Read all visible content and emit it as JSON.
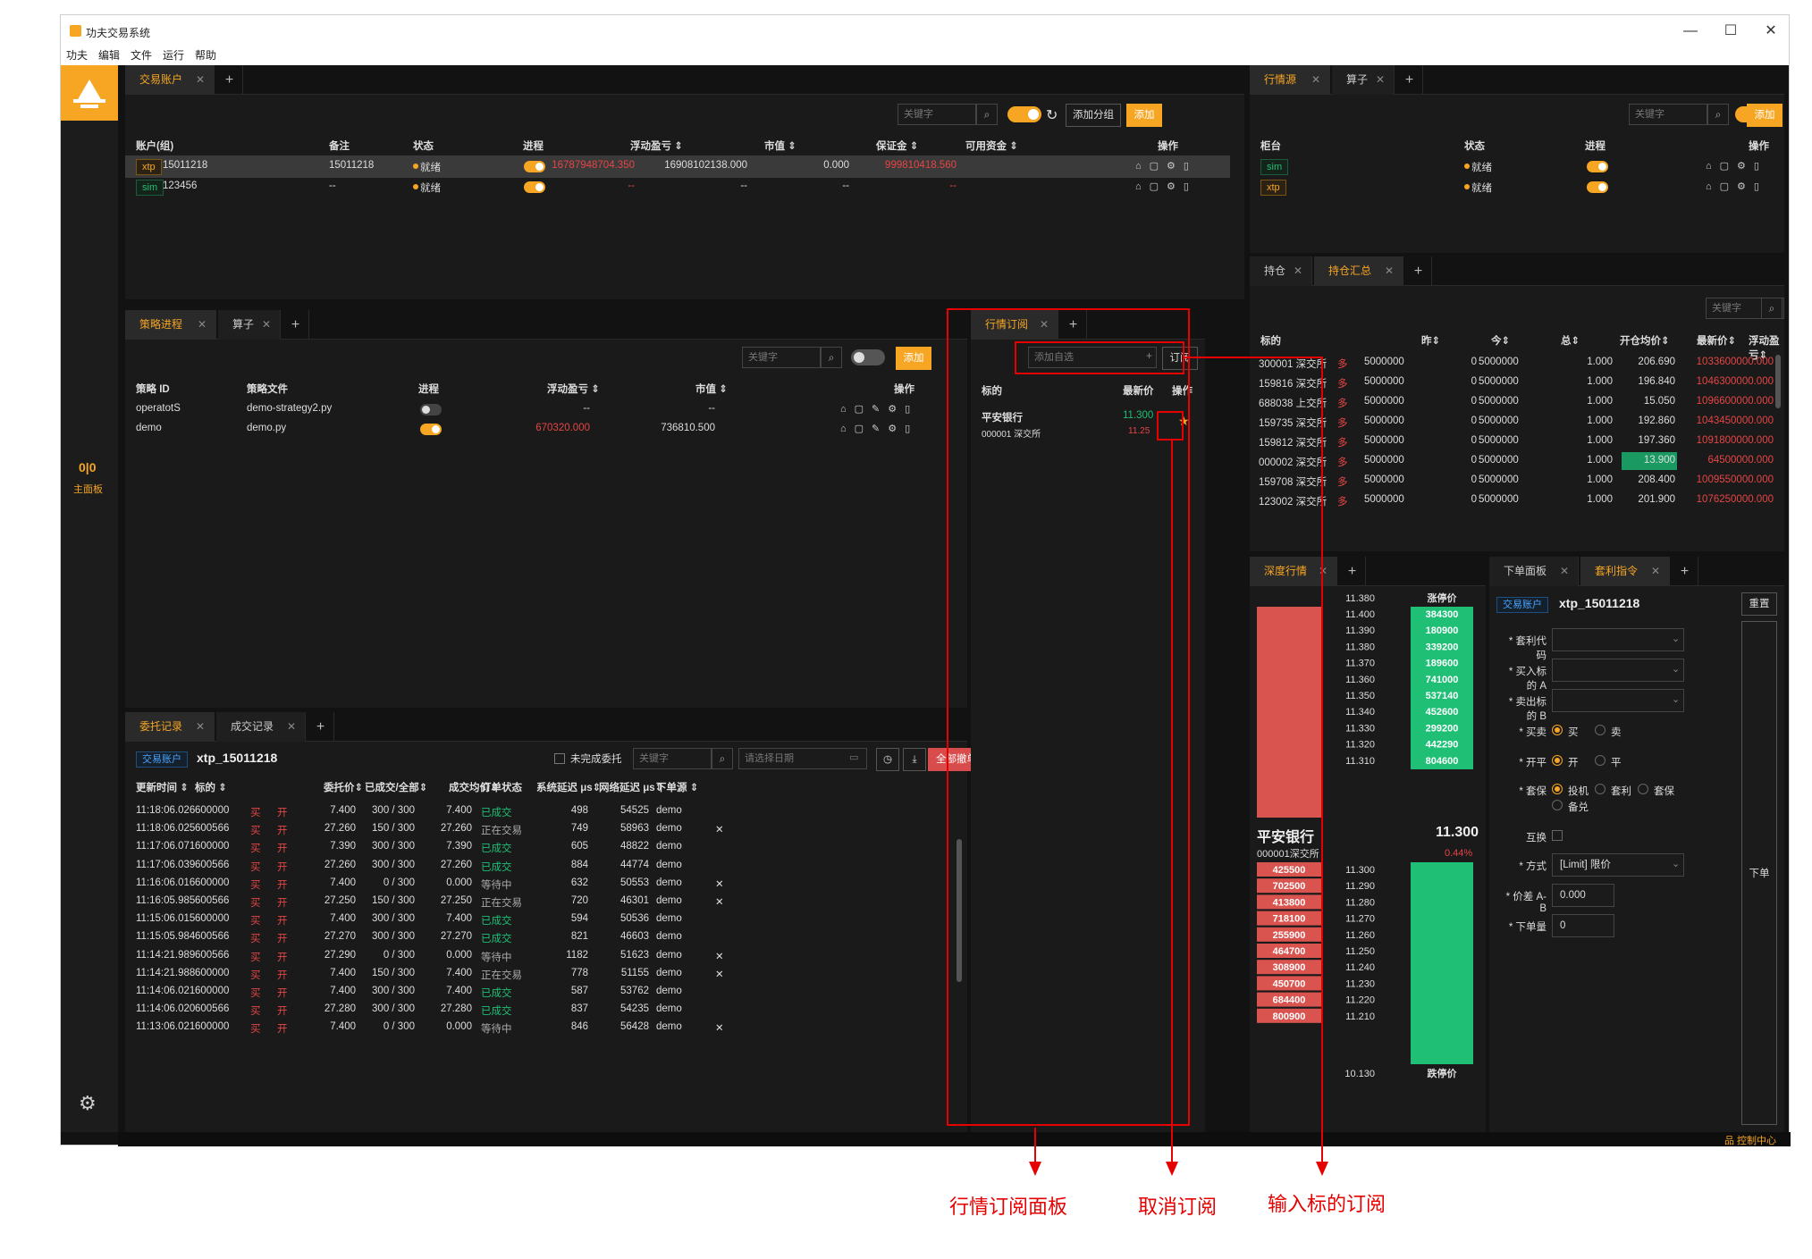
{
  "app": {
    "title": "功夫交易系统",
    "menu": [
      "功夫",
      "编辑",
      "文件",
      "运行",
      "帮助"
    ],
    "win_controls": [
      "—",
      "☐",
      "✕"
    ]
  },
  "sidebar": {
    "main_label": "主面板",
    "main_icon_text": "0|0"
  },
  "common": {
    "search_placeholder": "关键字",
    "add": "添加",
    "add_group": "添加分组",
    "close": "✕",
    "plus": "+"
  },
  "accounts": {
    "tab": "交易账户",
    "headers": [
      "账户(组)",
      "备注",
      "状态",
      "进程",
      "浮动盈亏 ⇕",
      "市值 ⇕",
      "保证金 ⇕",
      "可用资金 ⇕",
      "操作"
    ],
    "rows": [
      {
        "source": "xtp",
        "id": "15011218",
        "note": "15011218",
        "status": "就绪",
        "pnl": "16787948704.350",
        "mv": "16908102138.000",
        "margin": "0.000",
        "avail": "999810418.560",
        "selected": true
      },
      {
        "source": "sim",
        "id": "123456",
        "note": "--",
        "status": "就绪",
        "pnl": "--",
        "mv": "--",
        "margin": "--",
        "avail": "--",
        "selected": false
      }
    ]
  },
  "md_source": {
    "tabs": [
      "行情源",
      "算子"
    ],
    "headers": [
      "柜台",
      "状态",
      "进程",
      "操作"
    ],
    "rows": [
      {
        "source": "sim",
        "status": "就绪"
      },
      {
        "source": "xtp",
        "status": "就绪"
      }
    ]
  },
  "positions": {
    "tabs": [
      "持仓",
      "持仓汇总"
    ],
    "headers": [
      "标的",
      "昨⇕",
      "今⇕",
      "总⇕",
      "开仓均价⇕",
      "最新价⇕",
      "浮动盈亏⇕"
    ],
    "rows": [
      [
        "300001 深交所",
        "多",
        "5000000",
        "0",
        "5000000",
        "1.000",
        "206.690",
        "1033600000.000"
      ],
      [
        "159816 深交所",
        "多",
        "5000000",
        "0",
        "5000000",
        "1.000",
        "196.840",
        "1046300000.000"
      ],
      [
        "688038 上交所",
        "多",
        "5000000",
        "0",
        "5000000",
        "1.000",
        "15.050",
        "1096600000.000"
      ],
      [
        "159735 深交所",
        "多",
        "5000000",
        "0",
        "5000000",
        "1.000",
        "192.860",
        "1043450000.000"
      ],
      [
        "159812 深交所",
        "多",
        "5000000",
        "0",
        "5000000",
        "1.000",
        "197.360",
        "1091800000.000"
      ],
      [
        "000002 深交所",
        "多",
        "5000000",
        "0",
        "5000000",
        "1.000",
        "13.900",
        "64500000.000"
      ],
      [
        "159708 深交所",
        "多",
        "5000000",
        "0",
        "5000000",
        "1.000",
        "208.400",
        "1009550000.000"
      ],
      [
        "123002 深交所",
        "多",
        "5000000",
        "0",
        "5000000",
        "1.000",
        "201.900",
        "1076250000.000"
      ]
    ]
  },
  "strategy": {
    "tabs": [
      "策略进程",
      "算子"
    ],
    "headers": [
      "策略 ID",
      "策略文件",
      "进程",
      "浮动盈亏 ⇕",
      "市值 ⇕",
      "操作"
    ],
    "rows": [
      {
        "id": "operatotS",
        "file": "demo-strategy2.py",
        "on": false,
        "pnl": "--",
        "mv": "--"
      },
      {
        "id": "demo",
        "file": "demo.py",
        "on": true,
        "pnl": "670320.000",
        "mv": "736810.500"
      }
    ]
  },
  "market_sub": {
    "tab": "行情订阅",
    "input_placeholder": "添加自选",
    "subscribe_btn": "订阅",
    "headers": [
      "标的",
      "最新价",
      "操作"
    ],
    "rows": [
      {
        "name": "平安银行",
        "code": "000001 深交所",
        "price": "11.300",
        "sub_price": "11.25"
      }
    ]
  },
  "depth": {
    "tab": "深度行情",
    "name": "平安银行",
    "code": "000001深交所",
    "price": "11.300",
    "change": "0.44%",
    "top_price": "11.380",
    "bottom_price": "10.130",
    "limit_up": "涨停价",
    "limit_down": "跌停价",
    "ask_prices": [
      "11.400",
      "11.390",
      "11.380",
      "11.370",
      "11.360",
      "11.350",
      "11.340",
      "11.330",
      "11.320",
      "11.310"
    ],
    "ask_vols": [
      "384300",
      "180900",
      "339200",
      "189600",
      "741000",
      "537140",
      "452600",
      "299200",
      "442290",
      "804600"
    ],
    "bid_prices": [
      "11.300",
      "11.290",
      "11.280",
      "11.270",
      "11.260",
      "11.250",
      "11.240",
      "11.230",
      "11.220",
      "11.210"
    ],
    "bid_vols": [
      "425500",
      "702500",
      "413800",
      "718100",
      "255900",
      "464700",
      "308900",
      "450700",
      "684400",
      "800900"
    ]
  },
  "order_panel": {
    "tabs": [
      "下单面板",
      "套利指令"
    ],
    "account_tag": "交易账户",
    "account": "xtp_15011218",
    "reset": "重置",
    "submit": "下单",
    "labels": [
      "* 套利代码",
      "* 买入标的 A",
      "* 卖出标的 B",
      "* 买卖",
      "* 开平",
      "* 套保",
      "互换",
      "* 方式",
      "* 价差 A-B",
      "* 下单量"
    ],
    "side_opts": [
      "买",
      "卖"
    ],
    "offset_opts": [
      "开",
      "平"
    ],
    "hedge_opts": [
      "投机",
      "套利",
      "套保",
      "备兑"
    ],
    "method": "[Limit] 限价",
    "spread": "0.000",
    "volume": "0"
  },
  "orders": {
    "tabs": [
      "委托记录",
      "成交记录"
    ],
    "account_tag": "交易账户",
    "account": "xtp_15011218",
    "unfinished": "未完成委托",
    "date_placeholder": "请选择日期",
    "cancel_all": "全部撤单",
    "headers": [
      "更新时间 ⇕",
      "标的 ⇕",
      "",
      "",
      "委托价⇕",
      "已成交/全部⇕",
      "成交均价⇕",
      "订单状态",
      "系统延迟 μs⇕",
      "网络延迟 μs⇕",
      "下单源 ⇕"
    ],
    "rows": [
      [
        "11:18:06.026",
        "600000",
        "买",
        "开",
        "7.400",
        "300 / 300",
        "7.400",
        "已成交",
        "498",
        "54525",
        "demo",
        ""
      ],
      [
        "11:18:06.025",
        "600566",
        "买",
        "开",
        "27.260",
        "150 / 300",
        "27.260",
        "正在交易",
        "749",
        "58963",
        "demo",
        "✕"
      ],
      [
        "11:17:06.071",
        "600000",
        "买",
        "开",
        "7.390",
        "300 / 300",
        "7.390",
        "已成交",
        "605",
        "48822",
        "demo",
        ""
      ],
      [
        "11:17:06.039",
        "600566",
        "买",
        "开",
        "27.260",
        "300 / 300",
        "27.260",
        "已成交",
        "884",
        "44774",
        "demo",
        ""
      ],
      [
        "11:16:06.016",
        "600000",
        "买",
        "开",
        "7.400",
        "0 / 300",
        "0.000",
        "等待中",
        "632",
        "50553",
        "demo",
        "✕"
      ],
      [
        "11:16:05.985",
        "600566",
        "买",
        "开",
        "27.250",
        "150 / 300",
        "27.250",
        "正在交易",
        "720",
        "46301",
        "demo",
        "✕"
      ],
      [
        "11:15:06.015",
        "600000",
        "买",
        "开",
        "7.400",
        "300 / 300",
        "7.400",
        "已成交",
        "594",
        "50536",
        "demo",
        ""
      ],
      [
        "11:15:05.984",
        "600566",
        "买",
        "开",
        "27.270",
        "300 / 300",
        "27.270",
        "已成交",
        "821",
        "46603",
        "demo",
        ""
      ],
      [
        "11:14:21.989",
        "600566",
        "买",
        "开",
        "27.290",
        "0 / 300",
        "0.000",
        "等待中",
        "1182",
        "51623",
        "demo",
        "✕"
      ],
      [
        "11:14:21.988",
        "600000",
        "买",
        "开",
        "7.400",
        "150 / 300",
        "7.400",
        "正在交易",
        "778",
        "51155",
        "demo",
        "✕"
      ],
      [
        "11:14:06.021",
        "600000",
        "买",
        "开",
        "7.400",
        "300 / 300",
        "7.400",
        "已成交",
        "587",
        "53762",
        "demo",
        ""
      ],
      [
        "11:14:06.020",
        "600566",
        "买",
        "开",
        "27.280",
        "300 / 300",
        "27.280",
        "已成交",
        "837",
        "54235",
        "demo",
        ""
      ],
      [
        "11:13:06.021",
        "600000",
        "买",
        "开",
        "7.400",
        "0 / 300",
        "0.000",
        "等待中",
        "846",
        "56428",
        "demo",
        "✕"
      ]
    ]
  },
  "statusbar": {
    "control_center": "品 控制中心"
  },
  "annotations": [
    "行情订阅面板",
    "取消订阅",
    "输入标的订阅"
  ]
}
